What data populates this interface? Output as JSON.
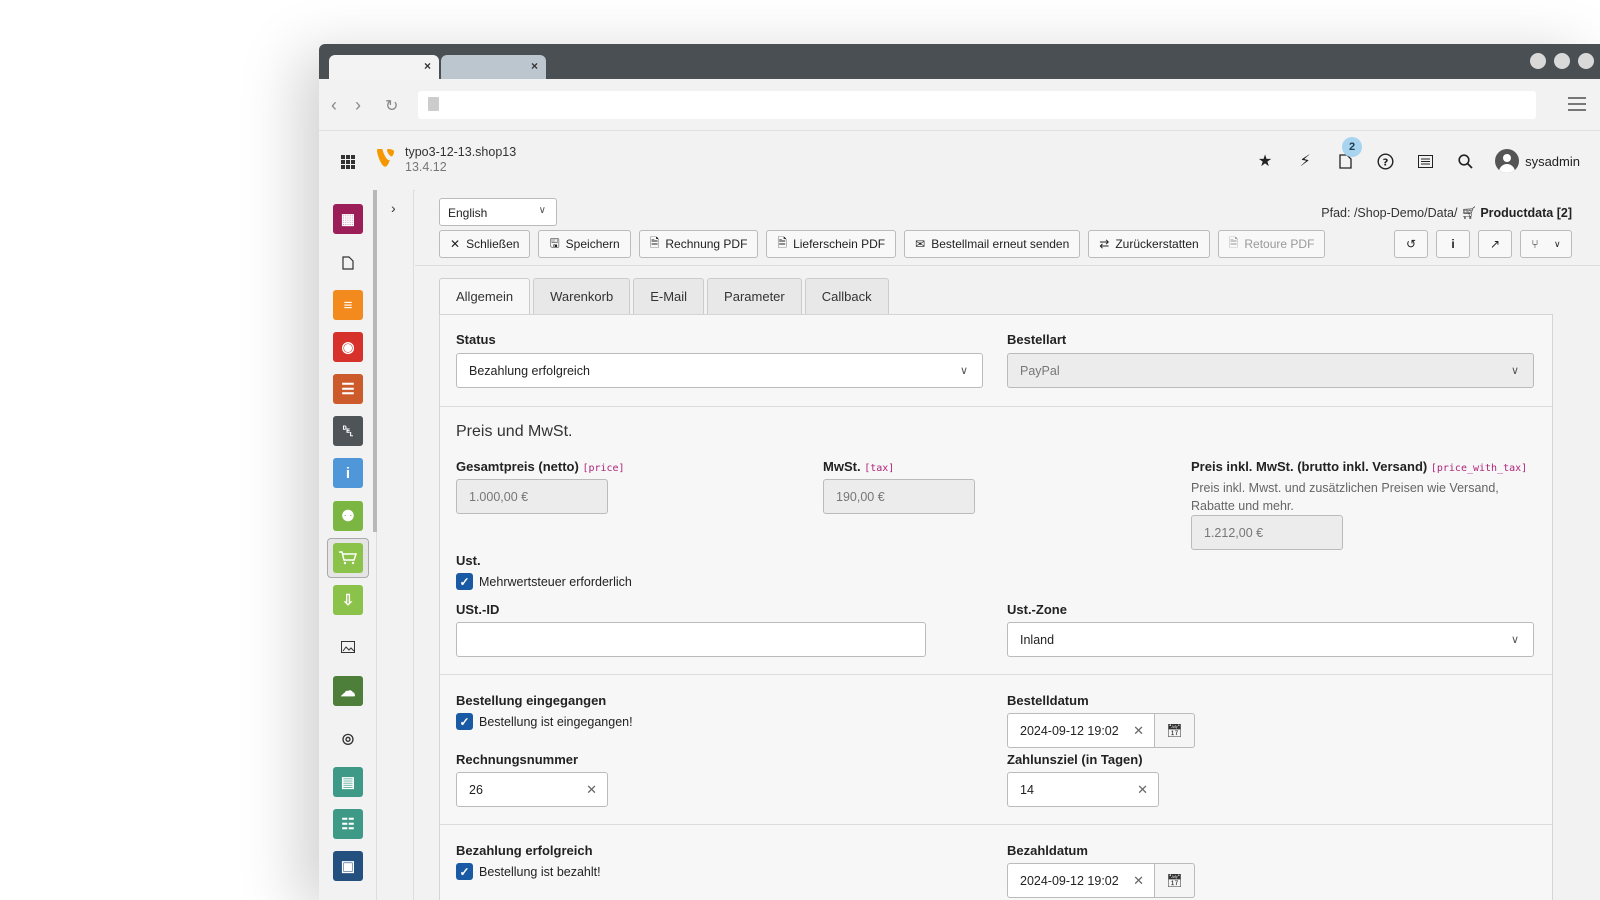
{
  "browser": {
    "tab_close": "×"
  },
  "topbar": {
    "site_name": "typo3-12-13.shop13",
    "version": "13.4.12",
    "notifications_count": "2",
    "username": "sysadmin"
  },
  "docheader": {
    "language": "English",
    "path_prefix": "Pfad: /Shop-Demo/Data/",
    "path_record": "Productdata [2]",
    "buttons": {
      "close": "Schließen",
      "save": "Speichern",
      "invoice_pdf": "Rechnung PDF",
      "delivery_pdf": "Lieferschein PDF",
      "resend_mail": "Bestellmail erneut senden",
      "refund": "Zurückerstatten",
      "return_pdf": "Retoure PDF"
    }
  },
  "form": {
    "tabs": [
      "Allgemein",
      "Warenkorb",
      "E-Mail",
      "Parameter",
      "Callback"
    ],
    "status": {
      "label": "Status",
      "value": "Bezahlung erfolgreich"
    },
    "order_type": {
      "label": "Bestellart",
      "value": "PayPal"
    },
    "price_section": {
      "title": "Preis und MwSt.",
      "net": {
        "label": "Gesamtpreis (netto)",
        "code": "[price]",
        "value": "1.000,00 €"
      },
      "tax": {
        "label": "MwSt.",
        "code": "[tax]",
        "value": "190,00 €"
      },
      "gross": {
        "label": "Preis inkl. MwSt. (brutto inkl. Versand)",
        "code": "[price_with_tax]",
        "description": "Preis inkl. Mwst. und zusätzlichen Preisen wie Versand, Rabatte und mehr.",
        "value": "1.212,00 €"
      },
      "vat": {
        "label": "Ust.",
        "checkbox": "Mehrwertsteuer erforderlich"
      },
      "vat_id": {
        "label": "USt.-ID",
        "value": ""
      },
      "vat_zone": {
        "label": "Ust.-Zone",
        "value": "Inland"
      }
    },
    "order_section": {
      "received": {
        "label": "Bestellung eingegangen",
        "checkbox": "Bestellung ist eingegangen!"
      },
      "order_date": {
        "label": "Bestelldatum",
        "value": "2024-09-12 19:02"
      },
      "invoice_number": {
        "label": "Rechnungsnummer",
        "value": "26"
      },
      "payment_term": {
        "label": "Zahlunsziel (in Tagen)",
        "value": "14"
      }
    },
    "payment_section": {
      "paid": {
        "label": "Bezahlung erfolgreich",
        "checkbox": "Bestellung ist bezahlt!"
      },
      "pay_date": {
        "label": "Bezahldatum",
        "value": "2024-09-12 19:02"
      }
    }
  },
  "colors": {
    "typo3_orange": "#f49700",
    "checkbox_blue": "#1a5aa5",
    "code_magenta": "#b0227a"
  },
  "icons": [
    "apps-icon",
    "typo3-logo",
    "star-icon",
    "bolt-icon",
    "document-icon",
    "help-icon",
    "list-icon",
    "search-icon",
    "user-icon"
  ]
}
